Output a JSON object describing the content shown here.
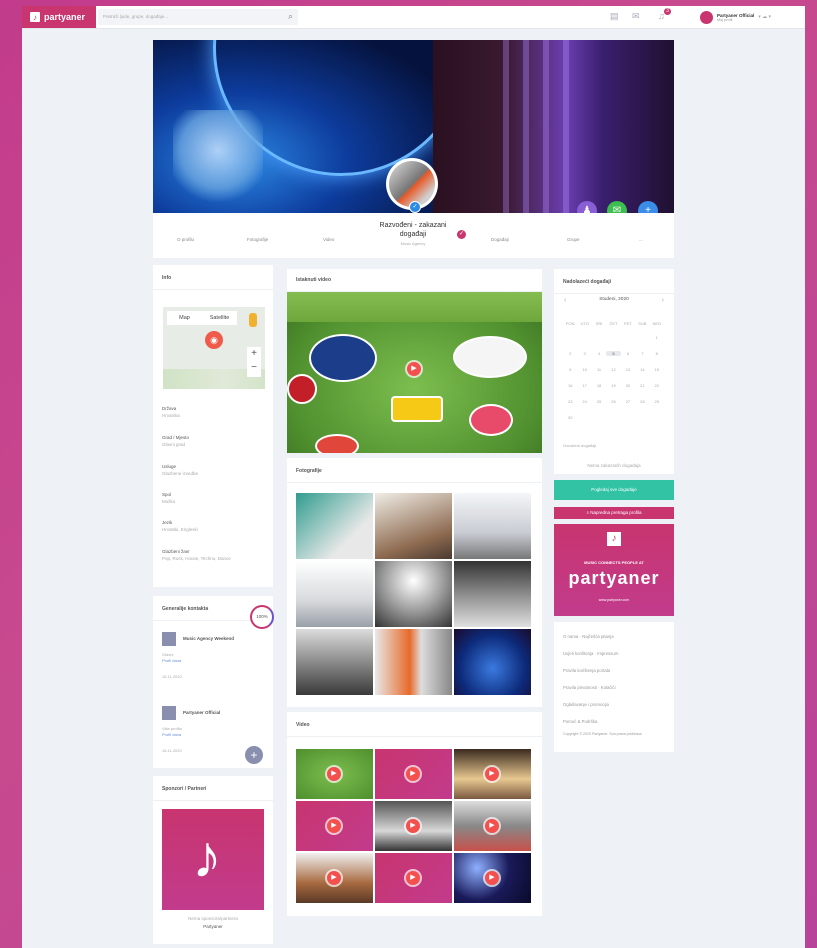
{
  "topbar": {
    "logo_text": "partyaner",
    "search_placeholder": "Pretraži ljude, grupe, događaje...",
    "user_name": "Partyaner Official",
    "user_sub": "Moj profil"
  },
  "profile": {
    "name": "Razvođeni - zakazani događaji",
    "category": "Music Agency",
    "nav": [
      "O profilu",
      "Fotografije",
      "Video",
      "Događaji",
      "Grupe",
      "..."
    ]
  },
  "info": {
    "title": "Info",
    "map_tab_map": "Map",
    "map_tab_satellite": "Satellite",
    "fields": [
      {
        "label": "Država",
        "value": "Hrvatska"
      },
      {
        "label": "Grad / Mjesto",
        "value": "Glavni grad"
      },
      {
        "label": "Usluge",
        "value": "Glazbene izvedbe"
      },
      {
        "label": "Spol",
        "value": "Muško"
      },
      {
        "label": "Jezik",
        "value": "Hrvatski, Engleski"
      },
      {
        "label": "Glazbeni žanr",
        "value": "Pop, Rock, House, Techno, Dance"
      }
    ]
  },
  "contacts": {
    "title": "Generalije kontakta",
    "percent": "100%",
    "items": [
      {
        "name": "Music Agency Weekend",
        "sub": "Glavni",
        "link": "Profil dana",
        "date": "16.11.2020"
      },
      {
        "name": "Partyaner Official",
        "sub": "Više profila",
        "link": "Profil dana",
        "date": "16.11.2020"
      }
    ]
  },
  "sponzori": {
    "title": "Sponzori / Partneri",
    "caption": "Nema sponzora/partnera",
    "brand": "Partyaner"
  },
  "video_main": {
    "title": "Istaknuti video"
  },
  "photos": {
    "title": "Fotografije"
  },
  "videos": {
    "title": "Video"
  },
  "calendar": {
    "title": "Nadolazeći događaji",
    "month": "Studeni, 2020",
    "weekdays": [
      "PON",
      "UTO",
      "SRI",
      "ČET",
      "PET",
      "SUB",
      "NED"
    ],
    "days": [
      "",
      "",
      "",
      "",
      "",
      "",
      "1",
      "2",
      "3",
      "4",
      "5",
      "6",
      "7",
      "8",
      "9",
      "10",
      "11",
      "12",
      "13",
      "14",
      "15",
      "16",
      "17",
      "18",
      "19",
      "20",
      "21",
      "22",
      "23",
      "24",
      "25",
      "26",
      "27",
      "28",
      "29",
      "30",
      "",
      "",
      "",
      "",
      "",
      ""
    ],
    "today": "5",
    "legend": "Označeni događaji",
    "empty": "Nema zakazanih događaja",
    "button_all": "Pogledaj sve događaje",
    "button_search": "Napredna pretraga profila"
  },
  "ad": {
    "slogan": "MUSIC CONNECTS PEOPLE AT",
    "brand": "partyaner",
    "sub": "www.partyaner.com"
  },
  "footer_links": [
    "O nama · Najčešća pitanja",
    "Uvjeti korištenja · Impressum",
    "Pravila korištenja portala",
    "Pravila privatnosti · Kolačići",
    "Oglašavanje i promocija",
    "Pomoć & Podrška",
    "Copyright © 2020 Partyaner. Sva prava pridržana."
  ],
  "colors": {
    "brand": "#c8356f",
    "teal": "#32c3a5",
    "fab_purple": "#8a5fd6",
    "fab_green": "#3cbf4e",
    "fab_blue": "#3a8eea"
  }
}
